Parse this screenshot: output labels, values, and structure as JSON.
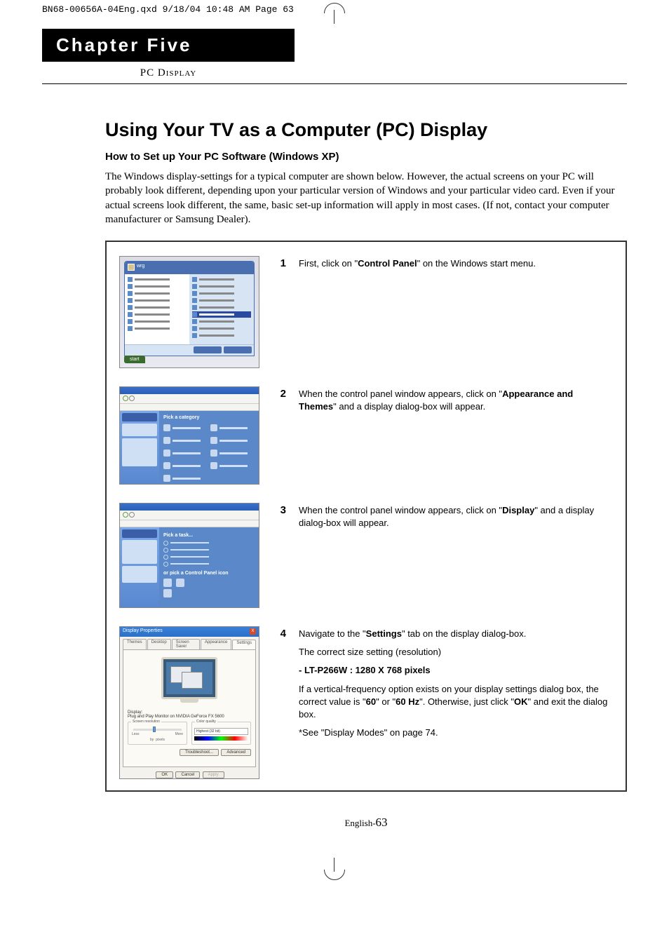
{
  "header_line": "BN68-00656A-04Eng.qxd  9/18/04 10:48 AM  Page 63",
  "chapter": {
    "banner": "Chapter Five",
    "subtitle_prefix": "PC ",
    "subtitle_smallcaps": "Display"
  },
  "heading1": "Using Your TV as a Computer (PC) Display",
  "heading2": "How to Set up Your PC Software (Windows XP)",
  "intro": "The Windows display-settings for a typical computer are shown below. However, the actual screens on your PC will probably look different, depending upon your particular version of Windows and your particular video card. Even if your actual screens look different, the same, basic set-up information will apply in most cases. (If not, contact your computer manufacturer or Samsung Dealer).",
  "steps": [
    {
      "num": "1",
      "paras": [
        {
          "segments": [
            {
              "t": "First, click on \""
            },
            {
              "t": "Control Panel",
              "b": true
            },
            {
              "t": "\" on the Windows start menu."
            }
          ]
        }
      ]
    },
    {
      "num": "2",
      "paras": [
        {
          "segments": [
            {
              "t": "When the control panel window appears, click on \""
            },
            {
              "t": "Appearance and Themes",
              "b": true
            },
            {
              "t": "\" and a display dialog-box will appear."
            }
          ]
        }
      ]
    },
    {
      "num": "3",
      "paras": [
        {
          "segments": [
            {
              "t": "When the control panel window appears, click on \""
            },
            {
              "t": "Display",
              "b": true
            },
            {
              "t": "\" and a display dialog-box will appear."
            }
          ]
        }
      ]
    },
    {
      "num": "4",
      "paras": [
        {
          "segments": [
            {
              "t": "Navigate to the \""
            },
            {
              "t": "Settings",
              "b": true
            },
            {
              "t": "\" tab on the display dialog-box."
            }
          ]
        },
        {
          "segments": [
            {
              "t": "The correct size setting (resolution)"
            }
          ]
        },
        {
          "segments": [
            {
              "t": "- LT-P266W : 1280 X 768 pixels",
              "b": true
            }
          ]
        },
        {
          "segments": [
            {
              "t": "If a vertical-frequency option exists on your display settings dialog box, the correct value is \""
            },
            {
              "t": "60",
              "b": true
            },
            {
              "t": "\" or \""
            },
            {
              "t": "60 Hz",
              "b": true
            },
            {
              "t": "\". Otherwise, just click \""
            },
            {
              "t": "OK",
              "b": true
            },
            {
              "t": "\" and exit the dialog box."
            }
          ]
        },
        {
          "segments": [
            {
              "t": "*See \"Display Modes\" on page 74."
            }
          ]
        }
      ]
    }
  ],
  "thumbs": {
    "start_menu": {
      "username": "wrg",
      "start_btn": "start"
    },
    "control_panel": {
      "pick_category": "Pick a category"
    },
    "appearance": {
      "pick_task": "Pick a task...",
      "or_pick": "or pick a Control Panel icon"
    },
    "display_props": {
      "title": "Display Properties",
      "close": "X",
      "tabs": [
        "Themes",
        "Desktop",
        "Screen Saver",
        "Appearance",
        "Settings"
      ],
      "active_tab": "Settings",
      "display_label": "Display:",
      "display_value": "Plug and Play Monitor on NVIDIA GeForce FX 5600",
      "screen_res_label": "Screen resolution",
      "less": "Less",
      "more": "More",
      "by": "by",
      "pixels": "pixels",
      "color_q_label": "Color quality",
      "color_q_value": "Highest (32 bit)",
      "btn_trouble": "Troubleshoot...",
      "btn_adv": "Advanced",
      "btn_ok": "OK",
      "btn_cancel": "Cancel",
      "btn_apply": "Apply"
    }
  },
  "footer": {
    "label": "English-",
    "num": "63"
  }
}
